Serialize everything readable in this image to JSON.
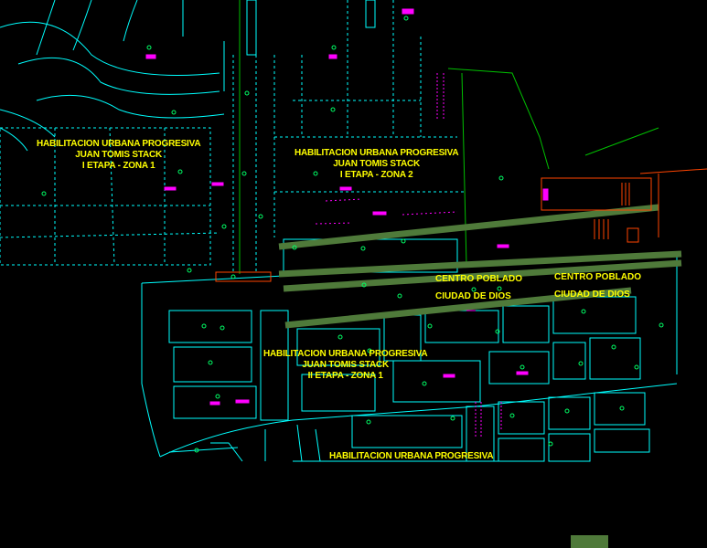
{
  "colors": {
    "background": "#000000",
    "block_lines": "#00ffff",
    "road_band": "#4f7a3a",
    "parcel_markers": "#00ff66",
    "labels": "#ffff00",
    "annotations": "#ff00ff",
    "boundary": "#00c000",
    "structures": "#ff4400"
  },
  "zones": [
    {
      "line1": "HABILITACION URBANA PROGRESIVA",
      "line2": "JUAN TOMIS STACK",
      "line3": "I ETAPA - ZONA 1"
    },
    {
      "line1": "HABILITACION URBANA PROGRESIVA",
      "line2": "JUAN TOMIS STACK",
      "line3": "I ETAPA - ZONA 2"
    },
    {
      "line1": "HABILITACION URBANA PROGRESIVA",
      "line2": "JUAN TOMIS STACK",
      "line3": "II ETAPA - ZONA 1"
    },
    {
      "line1": "HABILITACION URBANA PROGRESIVA"
    }
  ],
  "centro_poblado": [
    {
      "line1": "CENTRO POBLADO",
      "line2": "CIUDAD DE DIOS"
    },
    {
      "line1": "CENTRO POBLADO",
      "line2": "CIUDAD DE DIOS"
    }
  ],
  "icons": {
    "parcel_marker": "circle-marker-icon",
    "lot_annotation": "magenta-tag-icon"
  }
}
